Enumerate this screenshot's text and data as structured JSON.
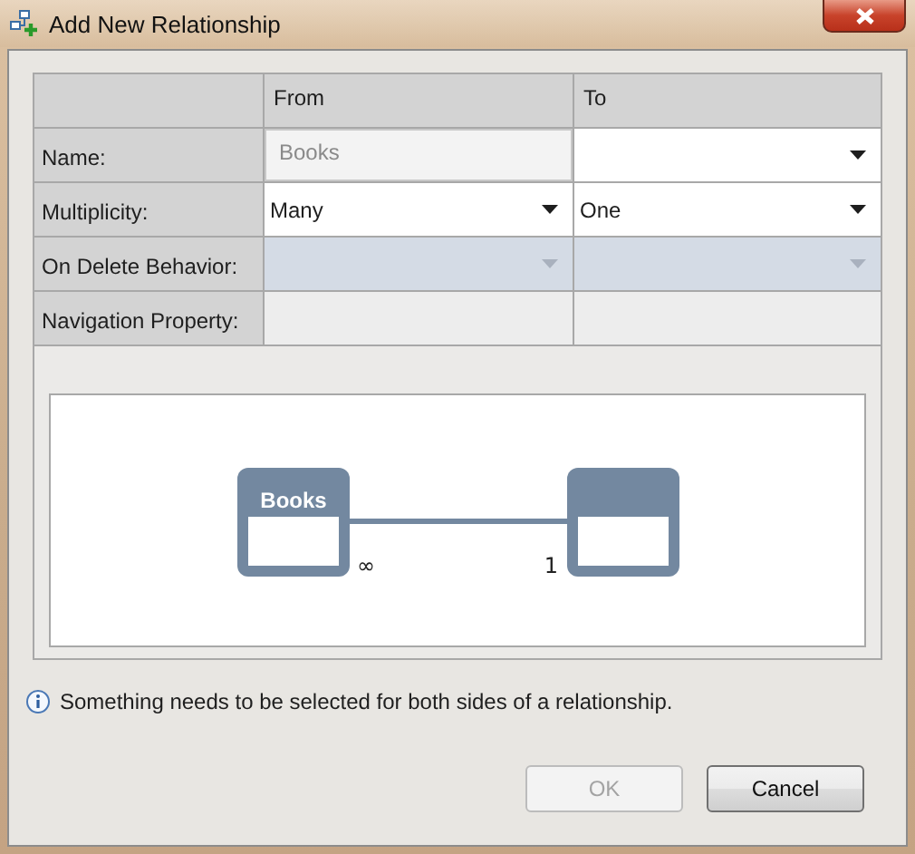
{
  "window": {
    "title": "Add New Relationship"
  },
  "table": {
    "columns": [
      "From",
      "To"
    ],
    "rows": [
      {
        "label": "Name:",
        "cells": [
          {
            "kind": "textbox",
            "value": "Books",
            "disabled": true
          },
          {
            "kind": "dropdown",
            "disabled": false
          }
        ]
      },
      {
        "label": "Multiplicity:",
        "cells": [
          {
            "kind": "dropdown",
            "value": "Many",
            "disabled": false
          },
          {
            "kind": "dropdown",
            "value": "One",
            "disabled": false
          }
        ]
      },
      {
        "label": "On Delete Behavior:",
        "cells": [
          {
            "kind": "dropdown",
            "disabled": true
          },
          {
            "kind": "dropdown",
            "disabled": true
          }
        ]
      },
      {
        "label": "Navigation Property:",
        "cells": [
          {
            "kind": "empty"
          },
          {
            "kind": "empty"
          }
        ]
      }
    ]
  },
  "diagram": {
    "from": {
      "name": "Books",
      "end": "∞"
    },
    "to": {
      "end": "1"
    }
  },
  "message": "Something needs to be selected for both sides of a relationship.",
  "buttons": [
    {
      "label": "OK",
      "disabled": true
    },
    {
      "label": "Cancel",
      "disabled": false
    }
  ]
}
